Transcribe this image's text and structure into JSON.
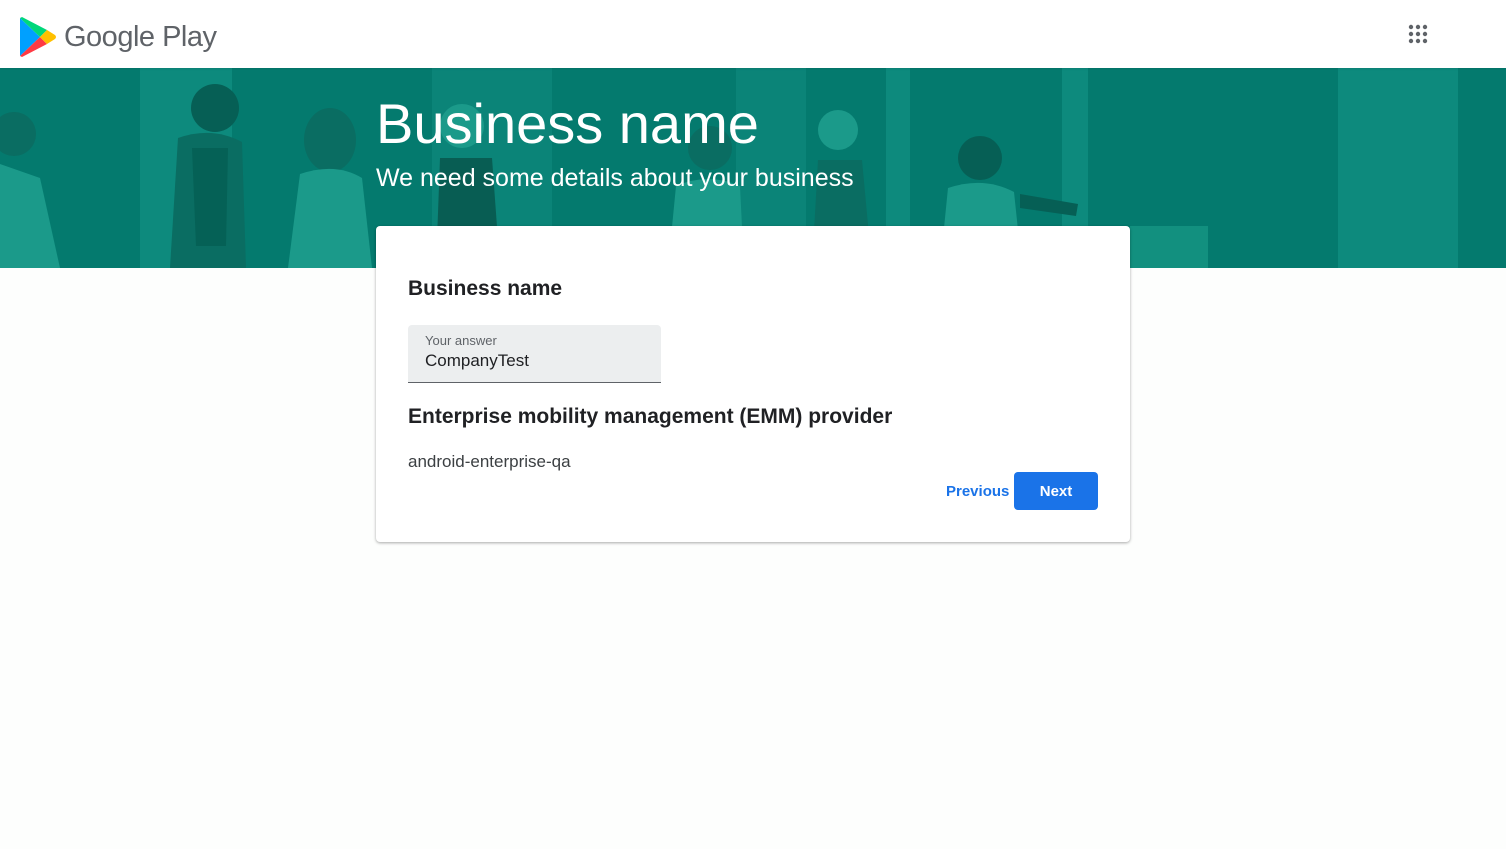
{
  "header": {
    "brand": "Google Play",
    "apps_icon": "apps-grid-icon"
  },
  "hero": {
    "title": "Business name",
    "subtitle": "We need some details about your business"
  },
  "form": {
    "business_name_title": "Business name",
    "answer_label": "Your answer",
    "answer_value": "CompanyTest",
    "emm_title": "Enterprise mobility management (EMM) provider",
    "emm_value": "android-enterprise-qa",
    "previous_label": "Previous",
    "next_label": "Next"
  },
  "colors": {
    "hero_bg": "#047a6e",
    "primary": "#1a73e8",
    "header_bg": "#ffffff",
    "field_bg": "#eceeef"
  }
}
